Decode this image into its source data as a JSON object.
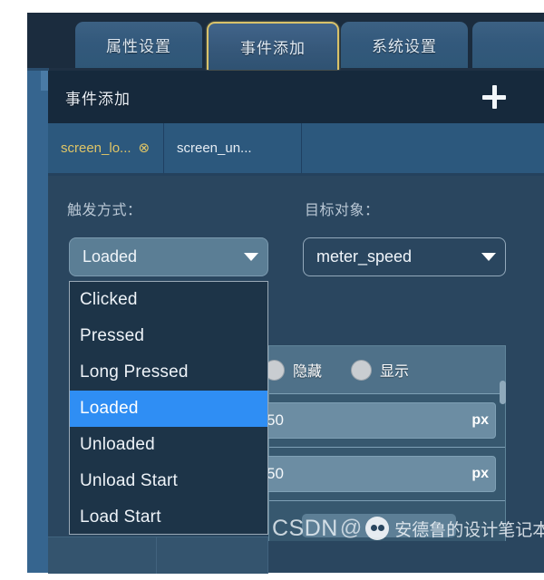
{
  "app": {
    "accent_gold": "#e0c566",
    "accent_blue": "#2f8ef4",
    "panel_bg": "#2a465f",
    "frame_bg": "#1f3043"
  },
  "top_tabs": [
    {
      "label": "属性设置",
      "active": false
    },
    {
      "label": "事件添加",
      "active": true
    },
    {
      "label": "系统设置",
      "active": false
    }
  ],
  "section_header": {
    "title": "事件添加",
    "add_icon": "plus-icon"
  },
  "sub_tabs": [
    {
      "label": "screen_lo...",
      "active": true,
      "close_icon": "⊗"
    },
    {
      "label": "screen_un...",
      "active": false
    }
  ],
  "form": {
    "trigger": {
      "label": "触发方式：",
      "value": "Loaded",
      "caret_icon": "chevron-down-icon"
    },
    "target": {
      "label": "目标对象：",
      "value": "meter_speed",
      "caret_icon": "chevron-down-icon"
    }
  },
  "dropdown": {
    "open": true,
    "selected": "Loaded",
    "options": [
      "Clicked",
      "Pressed",
      "Long Pressed",
      "Loaded",
      "Unloaded",
      "Unload Start",
      "Load Start"
    ]
  },
  "table": {
    "radio_row": {
      "options": [
        {
          "label": "隐藏",
          "checked": false
        },
        {
          "label": "显示",
          "checked": false
        }
      ]
    },
    "rows": [
      {
        "value": "50",
        "unit": "px"
      },
      {
        "value": "50",
        "unit": "px"
      }
    ]
  },
  "watermark": {
    "prefix": "CSDN",
    "at": "@",
    "logo_icon": "wechat-logo-icon",
    "name": "安德鲁的设计笔记本"
  }
}
